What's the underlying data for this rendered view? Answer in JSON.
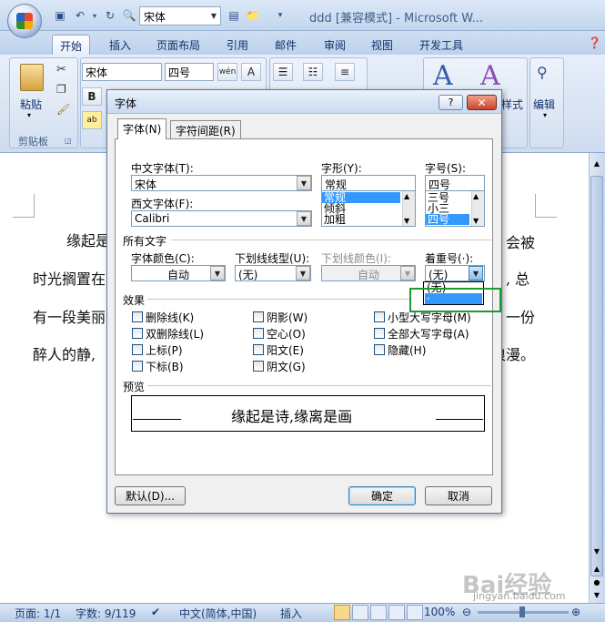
{
  "qat": {
    "font_value": "宋体"
  },
  "window": {
    "title": "ddd [兼容模式] - Microsoft W..."
  },
  "ribbon_tabs": [
    "开始",
    "插入",
    "页面布局",
    "引用",
    "邮件",
    "审阅",
    "视图",
    "开发工具"
  ],
  "ribbon": {
    "paste_label": "粘贴",
    "clipboard_label": "剪贴板",
    "font_name": "宋体",
    "font_size": "四号",
    "bold": "B",
    "styles_label": "样式",
    "edit_label": "编辑"
  },
  "document": {
    "lines": [
      "缘起是",
      "时光搁置在",
      "有一段美丽",
      "醉人的静,"
    ],
    "right_fragments": [
      "会被",
      ", 总",
      "一份",
      "浪漫。"
    ]
  },
  "dialog": {
    "title": "字体",
    "help": "?",
    "close": "✕",
    "tabs": [
      "字体(N)",
      "字符间距(R)"
    ],
    "labels": {
      "cn_font": "中文字体(T):",
      "west_font": "西文字体(F):",
      "style": "字形(Y):",
      "size": "字号(S):",
      "all_text": "所有文字",
      "font_color": "字体颜色(C):",
      "underline": "下划线线型(U):",
      "underline_color": "下划线颜色(I):",
      "emphasis": "着重号(·):",
      "effects": "效果",
      "preview": "预览"
    },
    "values": {
      "cn_font": "宋体",
      "west_font": "Calibri",
      "style": "常规",
      "size": "四号",
      "font_color": "自动",
      "underline": "(无)",
      "underline_color": "自动",
      "emphasis": "(无)"
    },
    "style_list": [
      "常规",
      "倾斜",
      "加粗"
    ],
    "size_list": [
      "三号",
      "小三",
      "四号"
    ],
    "emphasis_options": [
      "(无)",
      "·"
    ],
    "effects": {
      "col1": [
        "删除线(K)",
        "双删除线(L)",
        "上标(P)",
        "下标(B)"
      ],
      "col2": [
        "阴影(W)",
        "空心(O)",
        "阳文(E)",
        "阴文(G)"
      ],
      "col3": [
        "小型大写字母(M)",
        "全部大写字母(A)",
        "隐藏(H)"
      ]
    },
    "preview_text": "缘起是诗,缘离是画",
    "buttons": {
      "default": "默认(D)...",
      "ok": "确定",
      "cancel": "取消"
    }
  },
  "statusbar": {
    "page": "页面: 1/1",
    "words": "字数: 9/119",
    "lang": "中文(简体,中国)",
    "mode": "插入",
    "zoom": "100%"
  },
  "watermark": {
    "text": "Bai经验",
    "url": "jingyan.baidu.com"
  }
}
